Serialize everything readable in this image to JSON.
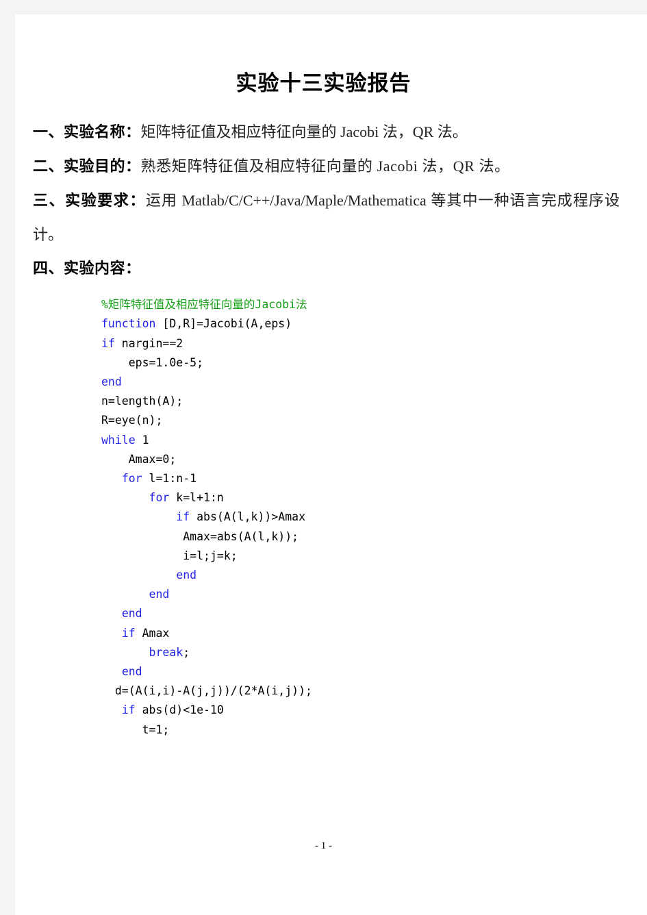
{
  "document": {
    "title": "实验十三实验报告",
    "page_footer": "- 1 -"
  },
  "sections": [
    {
      "lead": "一、实验名称：",
      "rest": "矩阵特征值及相应特征向量的 Jacobi 法，QR 法。"
    },
    {
      "lead": "二、实验目的：",
      "rest": "熟悉矩阵特征值及相应特征向量的 Jacobi 法，QR 法。"
    },
    {
      "lead": "三、实验要求：",
      "rest": "运用 Matlab/C/C++/Java/Maple/Mathematica 等其中一种语言完成程序设计。"
    },
    {
      "lead": "四、实验内容：",
      "rest": ""
    }
  ],
  "code": {
    "language": "matlab",
    "lines": [
      {
        "indent": 0,
        "parts": [
          {
            "t": "cmt",
            "s": "%矩阵特征值及相应特征向量的Jacobi法"
          }
        ]
      },
      {
        "indent": 0,
        "parts": [
          {
            "t": "kw",
            "s": "function"
          },
          {
            "t": "txt",
            "s": " [D,R]=Jacobi(A,eps)"
          }
        ]
      },
      {
        "indent": 0,
        "parts": [
          {
            "t": "kw",
            "s": "if"
          },
          {
            "t": "txt",
            "s": " nargin==2"
          }
        ]
      },
      {
        "indent": 4,
        "parts": [
          {
            "t": "txt",
            "s": "eps=1.0e-5;"
          }
        ]
      },
      {
        "indent": 0,
        "parts": [
          {
            "t": "kw",
            "s": "end"
          }
        ]
      },
      {
        "indent": 0,
        "parts": [
          {
            "t": "txt",
            "s": "n=length(A);"
          }
        ]
      },
      {
        "indent": 0,
        "parts": [
          {
            "t": "txt",
            "s": "R=eye(n);"
          }
        ]
      },
      {
        "indent": 0,
        "parts": [
          {
            "t": "kw",
            "s": "while"
          },
          {
            "t": "txt",
            "s": " 1"
          }
        ]
      },
      {
        "indent": 4,
        "parts": [
          {
            "t": "txt",
            "s": "Amax=0;"
          }
        ]
      },
      {
        "indent": 3,
        "parts": [
          {
            "t": "kw",
            "s": "for"
          },
          {
            "t": "txt",
            "s": " l=1:n-1"
          }
        ]
      },
      {
        "indent": 7,
        "parts": [
          {
            "t": "kw",
            "s": "for"
          },
          {
            "t": "txt",
            "s": " k=l+1:n"
          }
        ]
      },
      {
        "indent": 11,
        "parts": [
          {
            "t": "kw",
            "s": "if"
          },
          {
            "t": "txt",
            "s": " abs(A(l,k))>Amax"
          }
        ]
      },
      {
        "indent": 12,
        "parts": [
          {
            "t": "txt",
            "s": "Amax=abs(A(l,k));"
          }
        ]
      },
      {
        "indent": 12,
        "parts": [
          {
            "t": "txt",
            "s": "i=l;j=k;"
          }
        ]
      },
      {
        "indent": 11,
        "parts": [
          {
            "t": "kw",
            "s": "end"
          }
        ]
      },
      {
        "indent": 7,
        "parts": [
          {
            "t": "kw",
            "s": "end"
          }
        ]
      },
      {
        "indent": 3,
        "parts": [
          {
            "t": "kw",
            "s": "end"
          }
        ]
      },
      {
        "indent": 3,
        "parts": [
          {
            "t": "kw",
            "s": "if"
          },
          {
            "t": "txt",
            "s": " Amax"
          }
        ]
      },
      {
        "indent": 7,
        "parts": [
          {
            "t": "kw",
            "s": "break"
          },
          {
            "t": "txt",
            "s": ";"
          }
        ]
      },
      {
        "indent": 3,
        "parts": [
          {
            "t": "kw",
            "s": "end"
          }
        ]
      },
      {
        "indent": 2,
        "parts": [
          {
            "t": "txt",
            "s": "d=(A(i,i)-A(j,j))/(2*A(i,j));"
          }
        ]
      },
      {
        "indent": 3,
        "parts": [
          {
            "t": "kw",
            "s": "if"
          },
          {
            "t": "txt",
            "s": " abs(d)<1e-10"
          }
        ]
      },
      {
        "indent": 6,
        "parts": [
          {
            "t": "txt",
            "s": "t=1;"
          }
        ]
      }
    ]
  }
}
